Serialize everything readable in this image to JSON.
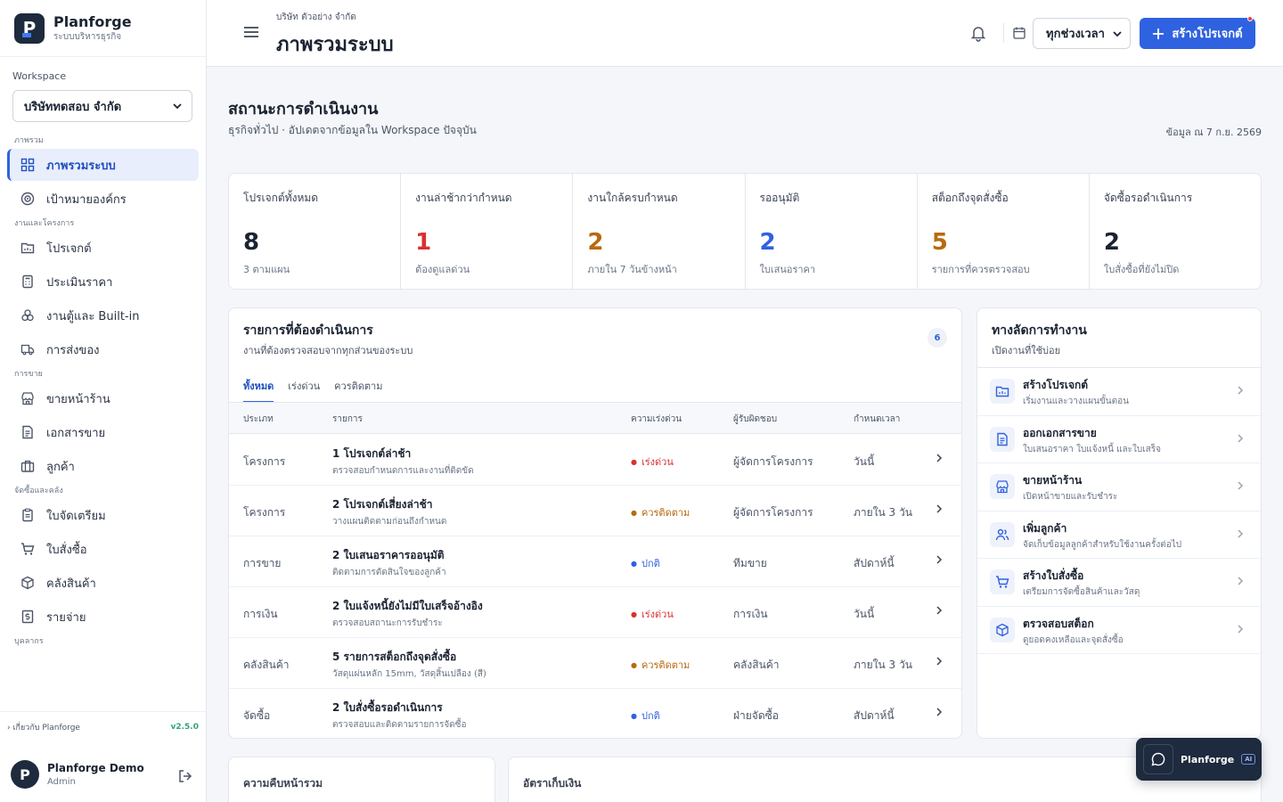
{
  "brand": {
    "name": "Planforge",
    "subtitle": "ระบบบริหารธุรกิจ",
    "logo_letter": "P"
  },
  "workspace": {
    "label": "Workspace",
    "selected": "บริษัททดสอบ จำกัด"
  },
  "nav": {
    "sections": [
      {
        "label": "ภาพรวม",
        "items": [
          {
            "label": "ภาพรวมระบบ",
            "icon": "grid-icon",
            "active": true
          },
          {
            "label": "เป้าหมายองค์กร",
            "icon": "target-icon"
          }
        ]
      },
      {
        "label": "งานและโครงการ",
        "items": [
          {
            "label": "โปรเจกต์",
            "icon": "project-icon"
          },
          {
            "label": "ประเมินราคา",
            "icon": "calculator-icon"
          },
          {
            "label": "งานตู้และ Built-in",
            "icon": "cabinet-icon"
          },
          {
            "label": "การส่งของ",
            "icon": "truck-icon"
          }
        ]
      },
      {
        "label": "การขาย",
        "items": [
          {
            "label": "ขายหน้าร้าน",
            "icon": "store-icon"
          },
          {
            "label": "เอกสารขาย",
            "icon": "document-icon"
          },
          {
            "label": "ลูกค้า",
            "icon": "customer-icon"
          }
        ]
      },
      {
        "label": "จัดซื้อและคลัง",
        "items": [
          {
            "label": "ใบจัดเตรียม",
            "icon": "clipboard-icon"
          },
          {
            "label": "ใบสั่งซื้อ",
            "icon": "cart-icon"
          },
          {
            "label": "คลังสินค้า",
            "icon": "box-icon"
          },
          {
            "label": "รายจ่าย",
            "icon": "money-icon"
          }
        ]
      },
      {
        "label": "บุคลากร",
        "items": []
      }
    ]
  },
  "sidebar_footer": {
    "about": "เกี่ยวกับ Planforge",
    "version": "v2.5.0"
  },
  "user": {
    "name": "Planforge Demo",
    "role": "Admin",
    "initial": "P"
  },
  "header": {
    "breadcrumb": "บริษัท ตัวอย่าง จำกัด",
    "title": "ภาพรวมระบบ",
    "range_selected": "ทุกช่วงเวลา",
    "create_label": "สร้างโปรเจกต์"
  },
  "section": {
    "title": "สถานะการดำเนินงาน",
    "subtitle": "ธุรกิจทั่วไป · อัปเดตจากข้อมูลใน Workspace ปัจจุบัน",
    "as_of": "ข้อมูล ณ 7 ก.ย. 2569"
  },
  "kpis": [
    {
      "label": "โปรเจกต์ทั้งหมด",
      "value": "8",
      "note": "3 ตามแผน",
      "color": "#1b2332"
    },
    {
      "label": "งานล่าช้ากว่ากำหนด",
      "value": "1",
      "note": "ต้องดูแลด่วน",
      "color": "#d8312f"
    },
    {
      "label": "งานใกล้ครบกำหนด",
      "value": "2",
      "note": "ภายใน 7 วันข้างหน้า",
      "color": "#b86a0c"
    },
    {
      "label": "รออนุมัติ",
      "value": "2",
      "note": "ใบเสนอราคา",
      "color": "#2f62e0"
    },
    {
      "label": "สต็อกถึงจุดสั่งซื้อ",
      "value": "5",
      "note": "รายการที่ควรตรวจสอบ",
      "color": "#b86a0c"
    },
    {
      "label": "จัดซื้อรอดำเนินการ",
      "value": "2",
      "note": "ใบสั่งซื้อที่ยังไม่ปิด",
      "color": "#1b2332"
    }
  ],
  "tasks": {
    "title": "รายการที่ต้องดำเนินการ",
    "subtitle": "งานที่ต้องตรวจสอบจากทุกส่วนของระบบ",
    "count": "6",
    "tabs": [
      "ทั้งหมด",
      "เร่งด่วน",
      "ควรติดตาม"
    ],
    "columns": {
      "type": "ประเภท",
      "item": "รายการ",
      "priority": "ความเร่งด่วน",
      "owner": "ผู้รับผิดชอบ",
      "due": "กำหนดเวลา"
    },
    "rows": [
      {
        "type": "โครงการ",
        "title": "1 โปรเจกต์ล่าช้า",
        "desc": "ตรวจสอบกำหนดการและงานที่ติดขัด",
        "priority": "เร่งด่วน",
        "level": "urgent",
        "owner": "ผู้จัดการโครงการ",
        "due": "วันนี้"
      },
      {
        "type": "โครงการ",
        "title": "2 โปรเจกต์เสี่ยงล่าช้า",
        "desc": "วางแผนติดตามก่อนถึงกำหนด",
        "priority": "ควรติดตาม",
        "level": "follow",
        "owner": "ผู้จัดการโครงการ",
        "due": "ภายใน 3 วัน"
      },
      {
        "type": "การขาย",
        "title": "2 ใบเสนอราคารออนุมัติ",
        "desc": "ติดตามการตัดสินใจของลูกค้า",
        "priority": "ปกติ",
        "level": "normal",
        "owner": "ทีมขาย",
        "due": "สัปดาห์นี้"
      },
      {
        "type": "การเงิน",
        "title": "2 ใบแจ้งหนี้ยังไม่มีใบเสร็จอ้างอิง",
        "desc": "ตรวจสอบสถานะการรับชำระ",
        "priority": "เร่งด่วน",
        "level": "urgent",
        "owner": "การเงิน",
        "due": "วันนี้"
      },
      {
        "type": "คลังสินค้า",
        "title": "5 รายการสต็อกถึงจุดสั่งซื้อ",
        "desc": "วัสดุแผ่นหลัก 15mm, วัสดุสิ้นเปลือง (สี)",
        "priority": "ควรติดตาม",
        "level": "follow",
        "owner": "คลังสินค้า",
        "due": "ภายใน 3 วัน"
      },
      {
        "type": "จัดซื้อ",
        "title": "2 ใบสั่งซื้อรอดำเนินการ",
        "desc": "ตรวจสอบและติดตามรายการจัดซื้อ",
        "priority": "ปกติ",
        "level": "normal",
        "owner": "ฝ่ายจัดซื้อ",
        "due": "สัปดาห์นี้"
      }
    ]
  },
  "shortcuts": {
    "title": "ทางลัดการทำงาน",
    "subtitle": "เปิดงานที่ใช้บ่อย",
    "items": [
      {
        "name": "สร้างโปรเจกต์",
        "desc": "เริ่มงานและวางแผนขั้นตอน",
        "icon": "project-icon"
      },
      {
        "name": "ออกเอกสารขาย",
        "desc": "ใบเสนอราคา ใบแจ้งหนี้ และใบเสร็จ",
        "icon": "document-icon"
      },
      {
        "name": "ขายหน้าร้าน",
        "desc": "เปิดหน้าขายและรับชำระ",
        "icon": "store-icon"
      },
      {
        "name": "เพิ่มลูกค้า",
        "desc": "จัดเก็บข้อมูลลูกค้าสำหรับใช้งานครั้งต่อไป",
        "icon": "users-icon"
      },
      {
        "name": "สร้างใบสั่งซื้อ",
        "desc": "เตรียมการจัดซื้อสินค้าและวัสดุ",
        "icon": "cart-icon"
      },
      {
        "name": "ตรวจสอบสต็อก",
        "desc": "ดูยอดคงเหลือและจุดสั่งซื้อ",
        "icon": "box-icon"
      }
    ]
  },
  "bottom_cards": {
    "progress": "ความคืบหน้ารวม",
    "collection": "อัตราเก็บเงิน"
  },
  "assistant": {
    "name": "Planforge",
    "tag": "AI"
  }
}
